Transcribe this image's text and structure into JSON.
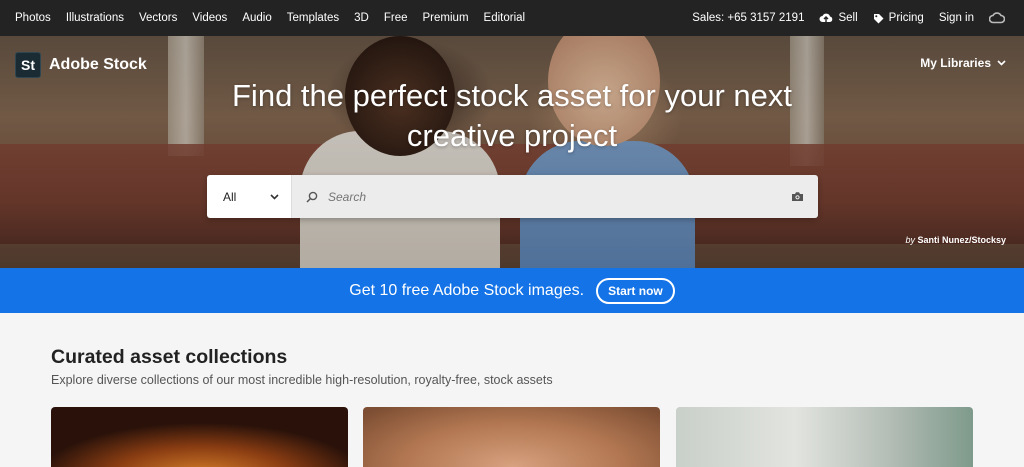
{
  "topnav": {
    "left_links": [
      "Photos",
      "Illustrations",
      "Vectors",
      "Videos",
      "Audio",
      "Templates",
      "3D",
      "Free",
      "Premium",
      "Editorial"
    ],
    "sales": "Sales: +65 3157 2191",
    "sell": "Sell",
    "pricing": "Pricing",
    "signin": "Sign in"
  },
  "hero": {
    "logo_badge": "St",
    "logo_name": "Adobe Stock",
    "my_libraries": "My Libraries",
    "headline_line1": "Find the perfect stock asset for your next",
    "headline_line2": "creative project",
    "search": {
      "category": "All",
      "placeholder": "Search"
    },
    "credit_by": "by",
    "credit_name": "Santi Nunez/Stocksy"
  },
  "promo": {
    "text": "Get 10 free Adobe Stock images.",
    "button": "Start now"
  },
  "collections": {
    "title": "Curated asset collections",
    "subtitle": "Explore diverse collections of our most incredible high-resolution, royalty-free, stock assets"
  },
  "colors": {
    "nav_bg": "#232323",
    "promo_blue": "#1473e6",
    "page_bg": "#f5f5f5"
  }
}
